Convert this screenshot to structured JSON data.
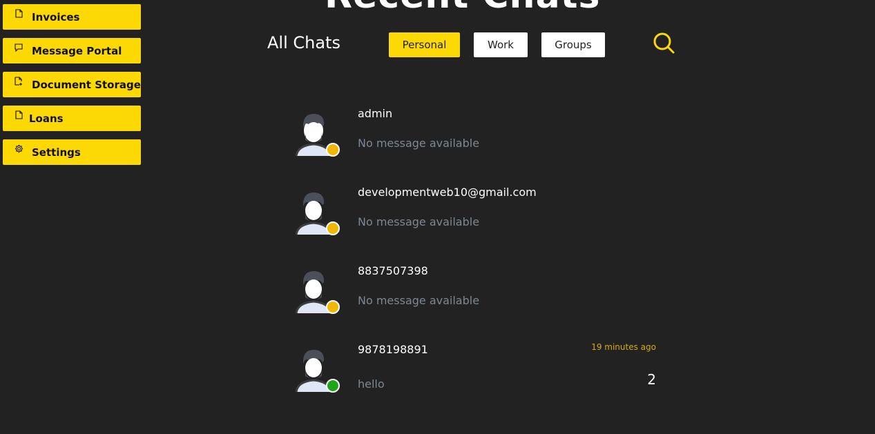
{
  "sidebar": {
    "items": [
      {
        "label": "Invoices",
        "icon": "file-icon"
      },
      {
        "label": "Message Portal",
        "icon": "message-icon"
      },
      {
        "label": "Document Storage",
        "icon": "document-add-icon"
      },
      {
        "label": "Loans",
        "icon": "file-icon"
      },
      {
        "label": "Settings",
        "icon": "gear-icon"
      }
    ]
  },
  "header": {
    "hero_title": "Recent Chats",
    "all_chats": "All Chats",
    "tabs": [
      {
        "label": "Personal",
        "active": true
      },
      {
        "label": "Work",
        "active": false
      },
      {
        "label": "Groups",
        "active": false
      }
    ],
    "search_icon": "search-icon"
  },
  "chats": [
    {
      "name": "admin",
      "preview": "No message available",
      "time": "",
      "unread": "",
      "status": "away"
    },
    {
      "name": "developmentweb10@gmail.com",
      "preview": "No message available",
      "time": "",
      "unread": "",
      "status": "away"
    },
    {
      "name": "8837507398",
      "preview": "No message available",
      "time": "",
      "unread": "",
      "status": "away"
    },
    {
      "name": "9878198891",
      "preview": "hello",
      "time": "19 minutes ago",
      "unread": "2",
      "status": "online"
    }
  ],
  "colors": {
    "background": "#222222",
    "accent": "#fcd804",
    "status_away": "#f2b705",
    "status_online": "#1fa51a",
    "timestamp": "#d7ad0f",
    "muted_text": "#7f8790"
  }
}
